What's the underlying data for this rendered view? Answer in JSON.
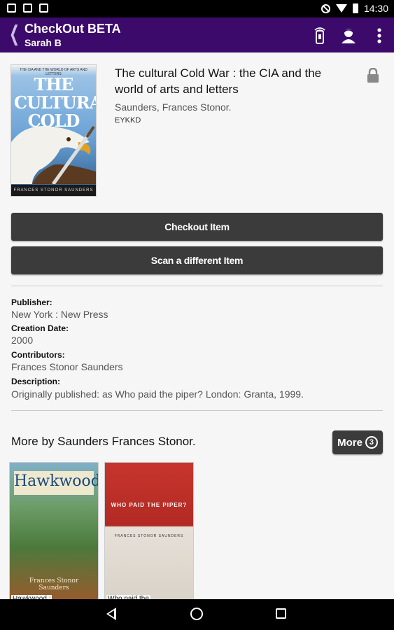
{
  "status_bar": {
    "time": "14:30"
  },
  "app_bar": {
    "title": "CheckOut BETA",
    "user": "Sarah B"
  },
  "item": {
    "title": "The cultural Cold War : the CIA and the world of arts and letters",
    "author": "Saunders, Frances Stonor.",
    "code": "EYKKD",
    "cover": {
      "top_text": "THE CIA AND THE WORLD OF ARTS AND LETTERS",
      "title": "THE CULTURAL COLD WAR",
      "author": "FRANCES STONOR SAUNDERS"
    }
  },
  "buttons": {
    "checkout": "Checkout Item",
    "scan": "Scan a different Item"
  },
  "details": {
    "publisher_label": "Publisher:",
    "publisher": "New York : New Press",
    "creation_label": "Creation Date:",
    "creation": "2000",
    "contributors_label": "Contributors:",
    "contributors": "Frances Stonor Saunders",
    "description_label": "Description:",
    "description": "Originally published: as Who paid the piper? London: Granta, 1999."
  },
  "more": {
    "heading": "More by Saunders Frances Stonor.",
    "button_label": "More",
    "count": "3",
    "items": [
      {
        "cover_title": "Hawkwood",
        "cover_author": "Frances Stonor Saunders",
        "caption": "Hawkwood :"
      },
      {
        "cover_title": "WHO PAID THE PIPER?",
        "cover_author": "FRANCES STONOR SAUNDERS",
        "caption": "Who paid the"
      }
    ]
  },
  "colors": {
    "app_bar": "#3c0a6b",
    "button": "#3b3b3b"
  }
}
